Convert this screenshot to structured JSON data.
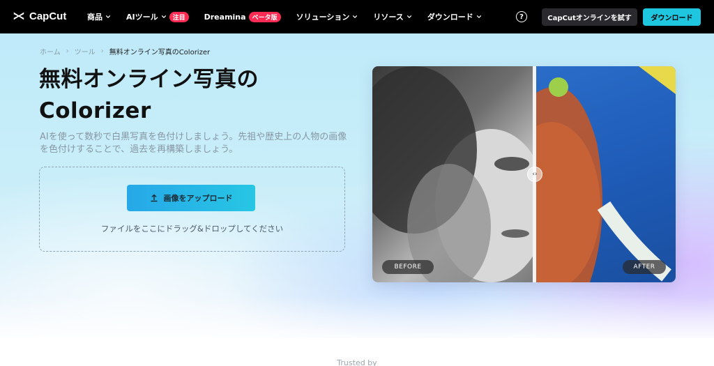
{
  "nav": {
    "logo_text": "CapCut",
    "items": [
      {
        "label": "商品",
        "badge": ""
      },
      {
        "label": "AIツール",
        "badge": "注目"
      },
      {
        "label": "Dreamina",
        "badge": "ベータ版"
      },
      {
        "label": "ソリューション",
        "badge": ""
      },
      {
        "label": "リソース",
        "badge": ""
      },
      {
        "label": "ダウンロード",
        "badge": ""
      }
    ],
    "help_label": "?",
    "try_online_label": "CapCutオンラインを試す",
    "download_label": "ダウンロード"
  },
  "breadcrumb": {
    "home": "ホーム",
    "tools": "ツール",
    "current": "無料オンライン写真のColorizer",
    "separator": "›"
  },
  "hero": {
    "title_line1": "無料オンライン写真の",
    "title_line2": "Colorizer",
    "description": "AIを使って数秒で白黒写真を色付けしましょう。先祖や歴史上の人物の画像を色付けすることで、過去を再構築しましょう。",
    "upload_label": "画像をアップロード",
    "drop_hint": "ファイルをここにドラッグ&ドロップしてください"
  },
  "compare": {
    "before_label": "BEFORE",
    "after_label": "AFTER",
    "handle_glyph": "‹›"
  },
  "footer": {
    "trusted_label": "Trusted by"
  },
  "colors": {
    "nav_bg": "#000000",
    "accent": "#1fc6df",
    "badge": "#fe2c55"
  }
}
